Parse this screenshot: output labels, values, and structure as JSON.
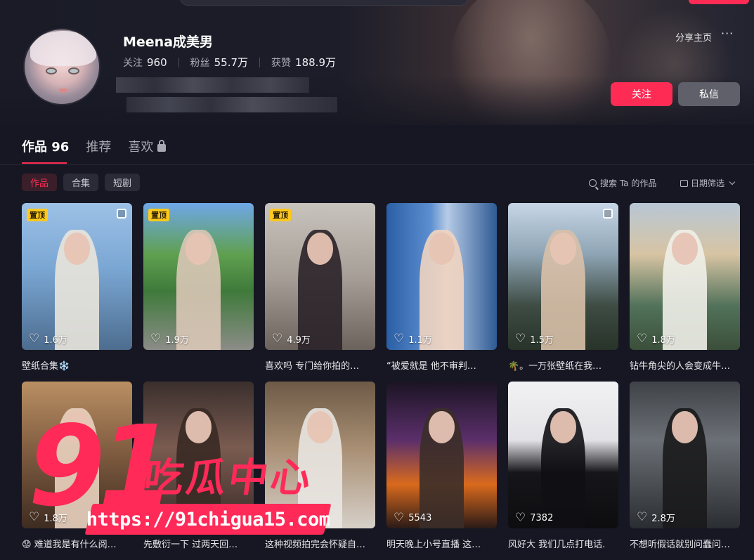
{
  "profile": {
    "name": "Meena成美男",
    "stats": [
      {
        "label": "关注",
        "value": "960"
      },
      {
        "label": "粉丝",
        "value": "55.7万"
      },
      {
        "label": "获赞",
        "value": "188.9万"
      }
    ],
    "share_label": "分享主页",
    "more_label": "···",
    "follow_label": "关注",
    "message_label": "私信"
  },
  "tabs": [
    {
      "label": "作品 96"
    },
    {
      "label": "推荐"
    },
    {
      "label": "喜欢"
    }
  ],
  "chips": [
    "作品",
    "合集",
    "短剧"
  ],
  "search_works": "搜索 Ta 的作品",
  "date_filter": "日期筛选",
  "pin_label": "置顶",
  "videos": [
    {
      "likes": "1.6万",
      "caption": "壁纸合集❄️",
      "pinned": true,
      "multi": true
    },
    {
      "likes": "1.9万",
      "caption": "",
      "pinned": true,
      "multi": false
    },
    {
      "likes": "4.9万",
      "caption": "喜欢吗 专门给你拍的…",
      "pinned": true,
      "multi": false
    },
    {
      "likes": "1.1万",
      "caption": "“被爱就是 他不审判…",
      "pinned": false,
      "multi": false
    },
    {
      "likes": "1.5万",
      "caption": "🌴。一万张壁纸在我…",
      "pinned": false,
      "multi": true
    },
    {
      "likes": "1.8万",
      "caption": "钻牛角尖的人会变成牛…",
      "pinned": false,
      "multi": false
    },
    {
      "likes": "1.8万",
      "caption": "😟 难道我是有什么阅…",
      "pinned": false,
      "multi": false
    },
    {
      "likes": "",
      "caption": "先敷衍一下 过两天回…",
      "pinned": false,
      "multi": false
    },
    {
      "likes": "",
      "caption": "这种视频拍完会怀疑自…",
      "pinned": false,
      "multi": false
    },
    {
      "likes": "5543",
      "caption": "明天晚上小号直播 这…",
      "pinned": false,
      "multi": false
    },
    {
      "likes": "7382",
      "caption": "风好大 我们几点打电话.",
      "pinned": false,
      "multi": false
    },
    {
      "likes": "2.8万",
      "caption": "不想听假话就别问蠢问…",
      "pinned": false,
      "multi": false
    }
  ],
  "watermark": {
    "number": "91",
    "text": "吃瓜中心",
    "url": "https://91chigua15.com"
  },
  "colors": {
    "accent": "#fe2c55",
    "background": "#161722",
    "pin": "#ffc81e"
  }
}
